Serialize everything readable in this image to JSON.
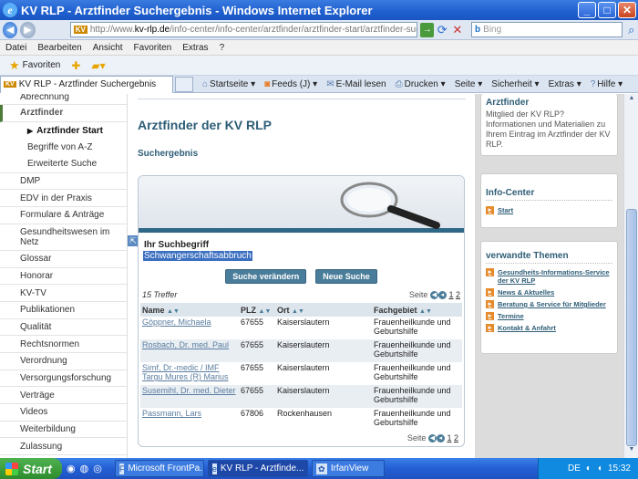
{
  "window": {
    "title": "KV RLP - Arztfinder Suchergebnis - Windows Internet Explorer",
    "minimize": "_",
    "maximize": "□",
    "close": "✕"
  },
  "addressbar": {
    "url_prefix": "http://www.",
    "url_domain": "kv-rlp.de",
    "url_rest": "/info-center/info-center/arztfinder/arztfinder-start/arztfinder-suchergebnis",
    "search_placeholder": "Bing"
  },
  "menu": [
    "Datei",
    "Bearbeiten",
    "Ansicht",
    "Favoriten",
    "Extras",
    "?"
  ],
  "favbar": {
    "favorites_label": "Favoriten"
  },
  "tab": {
    "label": "KV RLP - Arztfinder Suchergebnis"
  },
  "commands": {
    "home": "Startseite",
    "feeds": "Feeds (J)",
    "mail": "E-Mail lesen",
    "print": "Drucken",
    "page": "Seite",
    "security": "Sicherheit",
    "tools": "Extras",
    "help": "Hilfe"
  },
  "leftnav": {
    "items_top": [
      "Abrechnung"
    ],
    "active": "Arztfinder",
    "sub": [
      "Arztfinder Start",
      "Begriffe von A-Z",
      "Erweiterte Suche"
    ],
    "items": [
      "DMP",
      "EDV in der Praxis",
      "Formulare & Anträge",
      "Gesundheitswesen im Netz",
      "Glossar",
      "Honorar",
      "KV-TV",
      "Publikationen",
      "Qualität",
      "Rechtsnormen",
      "Verordnung",
      "Versorgungsforschung",
      "Verträge",
      "Videos",
      "Weiterbildung",
      "Zulassung"
    ]
  },
  "main": {
    "heading": "Arztfinder der KV RLP",
    "subheading": "Suchergebnis",
    "search_label": "Ihr Suchbegriff",
    "search_term": "Schwangerschaftsabbruch",
    "btn_change": "Suche verändern",
    "btn_new": "Neue Suche",
    "hits": "15 Treffer",
    "page_label": "Seite",
    "pages": [
      "1",
      "2"
    ],
    "columns": [
      "Name",
      "PLZ",
      "Ort",
      "Fachgebiet"
    ],
    "rows": [
      {
        "name": "Göppner, Michaela",
        "plz": "67655",
        "ort": "Kaiserslautern",
        "fach": "Frauenheilkunde und Geburtshilfe"
      },
      {
        "name": "Rosbach, Dr. med. Paul",
        "plz": "67655",
        "ort": "Kaiserslautern",
        "fach": "Frauenheilkunde und Geburtshilfe"
      },
      {
        "name": "Simf, Dr.-medic / IMF Targu Mures (R) Marius",
        "plz": "67655",
        "ort": "Kaiserslautern",
        "fach": "Frauenheilkunde und Geburtshilfe"
      },
      {
        "name": "Susemihl, Dr. med. Dieter",
        "plz": "67655",
        "ort": "Kaiserslautern",
        "fach": "Frauenheilkunde und Geburtshilfe"
      },
      {
        "name": "Passmann, Lars",
        "plz": "67806",
        "ort": "Rockenhausen",
        "fach": "Frauenheilkunde und Geburtshilfe"
      }
    ]
  },
  "right": {
    "box1_title": "Arztfinder",
    "box1_text": "Mitglied der KV RLP? Informationen und Materialien zu Ihrem Eintrag im Arztfinder der KV RLP.",
    "box2_title": "Info-Center",
    "box2_link": "Start",
    "box3_title": "verwandte Themen",
    "links": [
      "Gesundheits-Informations-Service der KV RLP",
      "News & Aktuelles",
      "Beratung & Service für Mitglieder",
      "Termine",
      "Kontakt & Anfahrt"
    ]
  },
  "taskbar": {
    "start": "Start",
    "tasks": [
      "Microsoft FrontPa...",
      "KV RLP - Arztfinde...",
      "IrfanView"
    ],
    "lang": "DE",
    "clock": "15:32"
  }
}
